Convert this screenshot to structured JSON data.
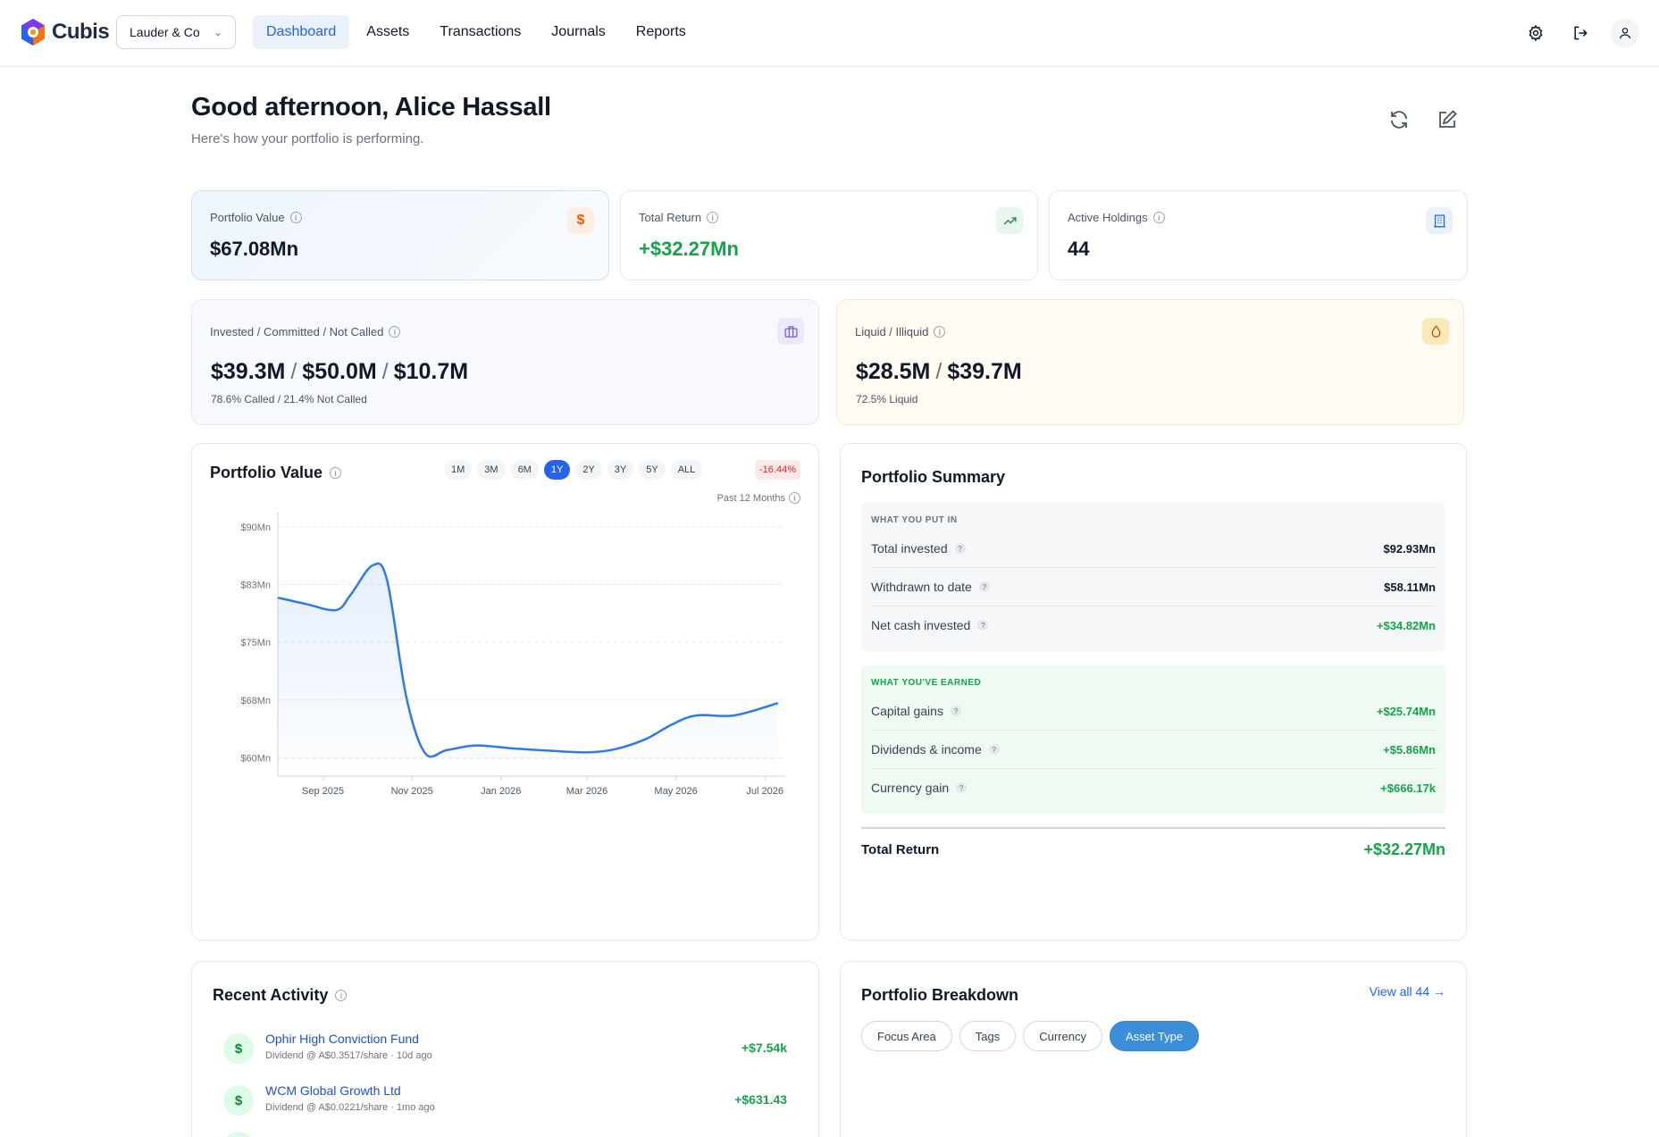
{
  "app": {
    "name": "Cubis"
  },
  "org_select": {
    "value": "Lauder & Co"
  },
  "nav": {
    "items": [
      {
        "label": "Dashboard",
        "active": true
      },
      {
        "label": "Assets",
        "active": false
      },
      {
        "label": "Transactions",
        "active": false
      },
      {
        "label": "Journals",
        "active": false
      },
      {
        "label": "Reports",
        "active": false
      }
    ]
  },
  "top_icons": [
    "gear-icon",
    "logout-icon",
    "user-icon"
  ],
  "header": {
    "greeting": "Good afternoon, Alice Hassall",
    "subtitle": "Here's how your portfolio is performing.",
    "actions": [
      "refresh-icon",
      "edit-icon"
    ]
  },
  "stats": {
    "portfolio_value": {
      "label": "Portfolio Value",
      "value": "$67.08Mn",
      "icon": "$"
    },
    "total_return": {
      "label": "Total Return",
      "value": "+$32.27Mn"
    },
    "active_holdings": {
      "label": "Active Holdings",
      "value": "44"
    }
  },
  "commitments": {
    "label": "Invested / Committed / Not Called",
    "invested": "$39.3M",
    "committed": "$50.0M",
    "not_called": "$10.7M",
    "separator": "/",
    "note": "78.6% Called / 21.4% Not Called"
  },
  "liquidity": {
    "label": "Liquid / Illiquid",
    "liquid": "$28.5M",
    "illiquid": "$39.7M",
    "separator": "/",
    "note": "72.5% Liquid"
  },
  "value_chart": {
    "title": "Portfolio Value",
    "ranges": [
      "1M",
      "3M",
      "6M",
      "1Y",
      "2Y",
      "3Y",
      "5Y",
      "ALL"
    ],
    "active_range": "1Y",
    "change": "-16.44%",
    "period": "Past 12 Months"
  },
  "chart_data": {
    "type": "area",
    "title": "",
    "xlabel": "",
    "ylabel": "",
    "x": [
      "2025-08-01",
      "2025-08-20",
      "2025-09-10",
      "2025-09-20",
      "2025-10-05",
      "2025-10-15",
      "2025-10-28",
      "2025-11-10",
      "2025-11-25",
      "2025-12-15",
      "2026-01-10",
      "2026-02-05",
      "2026-03-01",
      "2026-03-20",
      "2026-04-10",
      "2026-04-28",
      "2026-05-15",
      "2026-06-10",
      "2026-07-10"
    ],
    "values": [
      80.8,
      80.0,
      79.2,
      81.2,
      85.0,
      83.0,
      68.0,
      60.6,
      61.0,
      61.6,
      61.2,
      60.9,
      60.7,
      61.1,
      62.4,
      64.3,
      65.5,
      65.5,
      67.1
    ],
    "x_ticks": [
      "Sep 2025",
      "Nov 2025",
      "Jan 2026",
      "Mar 2026",
      "May 2026",
      "Jul 2026"
    ],
    "x_tick_dates": [
      "2025-09-01",
      "2025-11-01",
      "2026-01-01",
      "2026-03-01",
      "2026-05-01",
      "2026-07-01"
    ],
    "y_ticks": [
      "$90Mn",
      "$83Mn",
      "$75Mn",
      "$68Mn",
      "$60Mn"
    ],
    "y_tick_values": [
      90,
      82.5,
      75,
      67.5,
      60
    ],
    "ylim": [
      59,
      91.5
    ],
    "xlim": [
      "2025-08-01",
      "2026-07-15"
    ],
    "grid": true,
    "line_color": "#2f7ae5"
  },
  "summary": {
    "title": "Portfolio Summary",
    "put_in": {
      "heading": "WHAT YOU PUT IN",
      "rows": [
        {
          "label": "Total invested",
          "value": "$92.93Mn"
        },
        {
          "label": "Withdrawn to date",
          "value": "$58.11Mn"
        },
        {
          "label": "Net cash invested",
          "value": "+$34.82Mn"
        }
      ]
    },
    "earned": {
      "heading": "WHAT YOU'VE EARNED",
      "rows": [
        {
          "label": "Capital gains",
          "value": "+$25.74Mn"
        },
        {
          "label": "Dividends & income",
          "value": "+$5.86Mn"
        },
        {
          "label": "Currency gain",
          "value": "+$666.17k"
        }
      ]
    },
    "total": {
      "label": "Total Return",
      "value": "+$32.27Mn"
    }
  },
  "activity": {
    "title": "Recent Activity",
    "items": [
      {
        "name": "Ophir High Conviction Fund",
        "detail": "Dividend @ A$0.3517/share · 10d ago",
        "amount": "+$7.54k",
        "icon": "$"
      },
      {
        "name": "WCM Global Growth Ltd",
        "detail": "Dividend @ A$0.0221/share · 1mo ago",
        "amount": "+$631.43",
        "icon": "$"
      }
    ]
  },
  "breakdown": {
    "title": "Portfolio Breakdown",
    "view_all": "View all 44 →",
    "chips": [
      "Focus Area",
      "Tags",
      "Currency",
      "Asset Type"
    ],
    "active_chip": "Asset Type"
  },
  "colors": {
    "accent": "#2563eb",
    "positive": "#16a34a",
    "negative": "#dc2626"
  }
}
